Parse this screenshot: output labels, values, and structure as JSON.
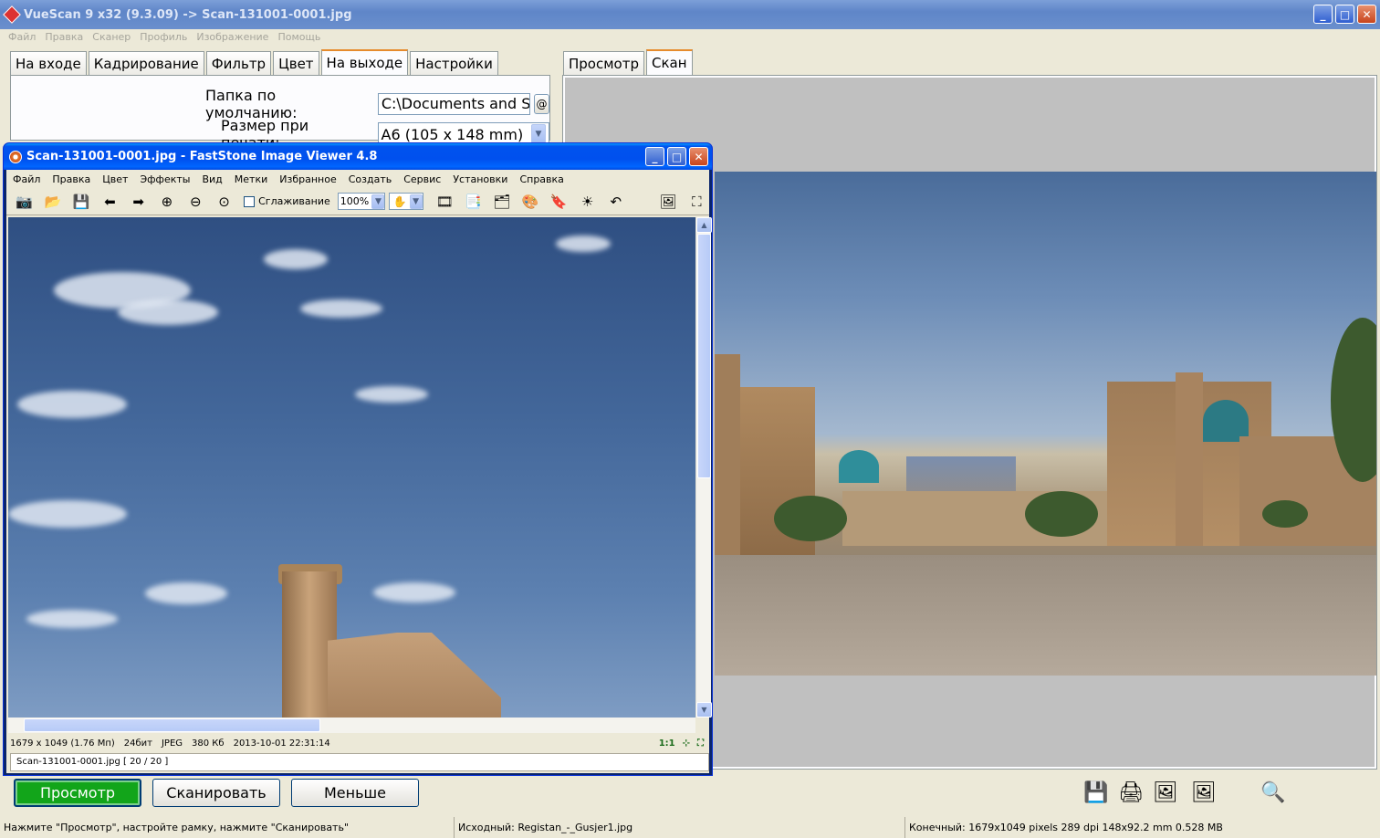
{
  "vuescan": {
    "title": "VueScan 9 x32 (9.3.09) -> Scan-131001-0001.jpg",
    "menu": [
      "Файл",
      "Правка",
      "Сканер",
      "Профиль",
      "Изображение",
      "Помощь"
    ],
    "tabs_left": [
      {
        "label": "На входе",
        "active": false
      },
      {
        "label": "Кадрирование",
        "active": false
      },
      {
        "label": "Фильтр",
        "active": false
      },
      {
        "label": "Цвет",
        "active": false
      },
      {
        "label": "На выходе",
        "active": true
      },
      {
        "label": "Настройки",
        "active": false
      }
    ],
    "form": {
      "folder_label": "Папка по умолчанию:",
      "folder_value": "C:\\Documents and Set",
      "folder_button": "@",
      "print_size_label": "Размер при печати:",
      "print_size_value": "A6 (105 x 148 mm)"
    },
    "tabs_right": [
      {
        "label": "Просмотр",
        "active": false
      },
      {
        "label": "Скан",
        "active": true
      }
    ],
    "buttons": {
      "preview": "Просмотр",
      "scan": "Сканировать",
      "less": "Меньше"
    },
    "status": {
      "hint": "Нажмите \"Просмотр\", настройте рамку, нажмите \"Сканировать\"",
      "source": "Исходный: Registan_-_Gusjer1.jpg",
      "output": "Конечный: 1679x1049 pixels 289 dpi 148x92.2 mm 0.528 MB"
    }
  },
  "faststone": {
    "title": "Scan-131001-0001.jpg  -  FastStone Image Viewer 4.8",
    "menu": [
      "Файл",
      "Правка",
      "Цвет",
      "Эффекты",
      "Вид",
      "Метки",
      "Избранное",
      "Создать",
      "Сервис",
      "Установки",
      "Справка"
    ],
    "smoothing_label": "Сглаживание",
    "zoom_value": "100%",
    "info": {
      "dimensions": "1679 x 1049 (1.76 Mп)",
      "bits": "24бит",
      "format": "JPEG",
      "size": "380 Кб",
      "date": "2013-10-01 22:31:14",
      "ratio": "1:1"
    },
    "file_line": "Scan-131001-0001.jpg [ 20 / 20 ]"
  }
}
